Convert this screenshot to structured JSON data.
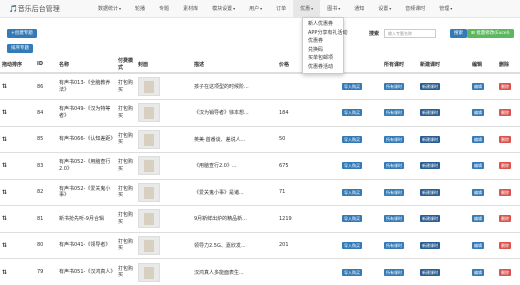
{
  "header": {
    "brand": "🎵音乐后台管理",
    "nav": [
      "数据统计",
      "轮播",
      "专题",
      "素材库",
      "模块设置",
      "用户",
      "订单",
      "优惠",
      "图书",
      "通知",
      "设置",
      "音频课时",
      "管理"
    ],
    "active_index": 7
  },
  "dropdown": [
    "新人优惠券",
    "APP分享有礼活动",
    "优惠券",
    "兑换码",
    "买单包邮项",
    "优惠券活动"
  ],
  "toolbar": {
    "create_label": "+创建专题",
    "sort_label": "排序专题",
    "search_label": "搜索",
    "search_placeholder": "输入专题名称",
    "search_button": "搜索",
    "batch_label": "批量修改(Excel)"
  },
  "table": {
    "headers": [
      "拖动排序",
      "ID",
      "名称",
      "付费模式",
      "封面",
      "描述",
      "价格",
      "",
      "",
      "所有课时",
      "新建课时",
      "编辑",
      "删除"
    ],
    "rows": [
      {
        "id": "86",
        "name": "有声书013-《全脑教养法》",
        "mode": "打包购买",
        "desc": "孩子在这项型的时候阶...",
        "price": ""
      },
      {
        "id": "84",
        "name": "有声书049-《汉为特等者》",
        "mode": "打包购买",
        "desc": "《汉为销导者》徐本想...",
        "price": "184"
      },
      {
        "id": "85",
        "name": "有声书066-《认知差距》",
        "mode": "打包购买",
        "desc": "英美·首番谈、差说人...",
        "price": "50"
      },
      {
        "id": "83",
        "name": "有声书052-《用脑查行2.0》",
        "mode": "打包购买",
        "desc": "《用脑查行2.0》...",
        "price": "675"
      },
      {
        "id": "82",
        "name": "有声书052-《爱关鬼小事》",
        "mode": "打包购买",
        "desc": "《爱关鬼小事》是诸...",
        "price": "71"
      },
      {
        "id": "81",
        "name": "新书抢先听-9月合辑",
        "mode": "打包购买",
        "desc": "9月新鲜出炉的精品新...",
        "price": "1219"
      },
      {
        "id": "80",
        "name": "有声书041-《领导者》",
        "mode": "打包购买",
        "desc": "领导力2.5G、嘉欣发...",
        "price": "201"
      },
      {
        "id": "79",
        "name": "有声书051-《汉鸿真人》",
        "mode": "打包购买",
        "desc": "汉鸿真人多能面表生...",
        "price": ""
      }
    ],
    "row_buttons": {
      "import": "导入购买",
      "all": "所有课时",
      "new": "新建课时",
      "edit": "编辑",
      "delete": "删除"
    }
  },
  "colors": {
    "primary": "#337ab7",
    "success": "#5cb85c",
    "danger": "#d9534f"
  }
}
